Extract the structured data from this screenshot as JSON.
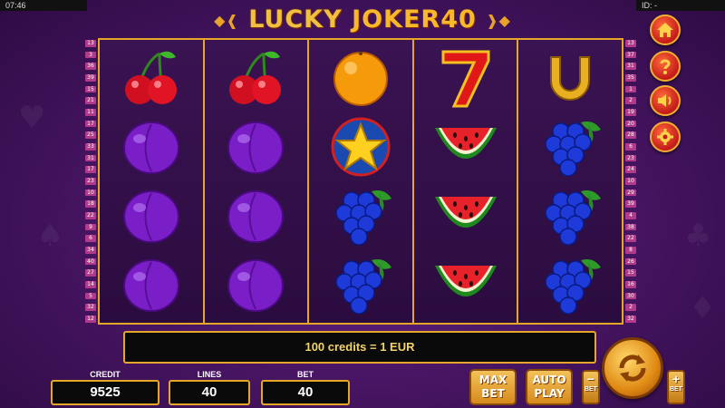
{
  "status": {
    "time": "07:46",
    "id_label": "ID: -"
  },
  "logo": {
    "word1": "LUCKY",
    "word2": "JOKER",
    "number": "40"
  },
  "paylines": {
    "left": [
      "13",
      "3",
      "36",
      "39",
      "15",
      "21",
      "11",
      "17",
      "25",
      "33",
      "31",
      "17",
      "23",
      "10",
      "18",
      "22",
      "9",
      "6",
      "34",
      "40",
      "27",
      "14",
      "5",
      "32",
      "12"
    ],
    "right": [
      "13",
      "37",
      "31",
      "35",
      "1",
      "2",
      "19",
      "20",
      "28",
      "6",
      "23",
      "24",
      "10",
      "29",
      "39",
      "4",
      "38",
      "22",
      "8",
      "26",
      "15",
      "16",
      "30",
      "2",
      "32"
    ]
  },
  "reels": [
    [
      "cherry",
      "plum",
      "plum",
      "plum"
    ],
    [
      "cherry",
      "plum",
      "plum",
      "plum"
    ],
    [
      "orange",
      "star",
      "grapes",
      "grapes"
    ],
    [
      "seven",
      "watermelon",
      "watermelon",
      "watermelon"
    ],
    [
      "horseshoe",
      "grapes",
      "grapes",
      "grapes"
    ]
  ],
  "side_icons": [
    "home-icon",
    "help-icon",
    "sound-icon",
    "settings-icon"
  ],
  "info": {
    "message": "100 credits = 1 EUR"
  },
  "credit": {
    "label": "CREDIT",
    "value": "9525"
  },
  "lines": {
    "label": "LINES",
    "value": "40"
  },
  "bet": {
    "label": "BET",
    "value": "40"
  },
  "buttons": {
    "max_bet_line1": "MAX",
    "max_bet_line2": "BET",
    "auto_play_line1": "AUTO",
    "auto_play_line2": "PLAY",
    "bet_minus_sign": "−",
    "bet_minus_label": "BET",
    "bet_plus_sign": "+",
    "bet_plus_label": "BET"
  },
  "colors": {
    "gold": "#e6a728",
    "bg": "#4a1666",
    "reel_bg": "#2b0c3f"
  }
}
